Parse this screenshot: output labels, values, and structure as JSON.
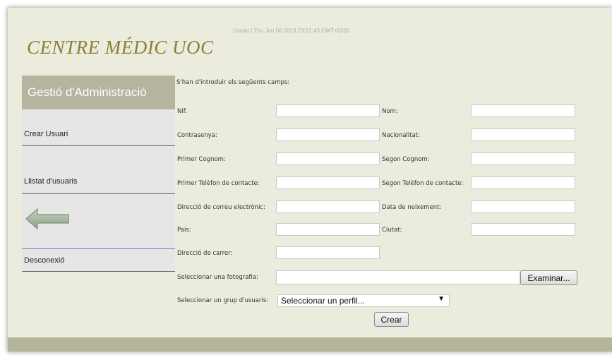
{
  "header": {
    "user_line": "Usuari | Thu Jun 06 2013 23:51:43 GMT+0200",
    "logo": "CENTRE MÉDIC UOC"
  },
  "sidebar": {
    "title": "Gestió d'Administració",
    "items": [
      {
        "label": "Crear Usuari"
      },
      {
        "label": "Llistat d'usuaris"
      },
      {
        "label": "Desconexió"
      }
    ],
    "back_icon": "left-arrow-icon"
  },
  "form": {
    "intro": "S'han d'introduir els següents camps:",
    "fields": [
      {
        "label": "Nif:",
        "value": ""
      },
      {
        "label": "Nom:",
        "value": ""
      },
      {
        "label": "Contrasenya:",
        "value": ""
      },
      {
        "label": "Nacionalitat:",
        "value": ""
      },
      {
        "label": "Primer Cognom:",
        "value": ""
      },
      {
        "label": "Segon Cognom:",
        "value": ""
      },
      {
        "label": "Primer Telèfon de contacte:",
        "value": ""
      },
      {
        "label": "Segon Telèfon de contacte:",
        "value": ""
      },
      {
        "label": "Direcció de correu electrònic:",
        "value": ""
      },
      {
        "label": "Data de neixement:",
        "value": ""
      },
      {
        "label": "Pais:",
        "value": ""
      },
      {
        "label": "Ciutat:",
        "value": ""
      },
      {
        "label": "Direcció de carrer:",
        "value": ""
      }
    ],
    "photo_label": "Seleccionar una fotografia:",
    "browse_button": "Examinar...",
    "group_label": "Seleccionar un grup d'usuaris:",
    "group_select": "Seleccionar un perfil...",
    "create_button": "Crear"
  },
  "colors": {
    "background": "#ebebde",
    "sidebar_header": "#b4b49f",
    "logo": "#8a8133",
    "footer": "#b4b498"
  }
}
